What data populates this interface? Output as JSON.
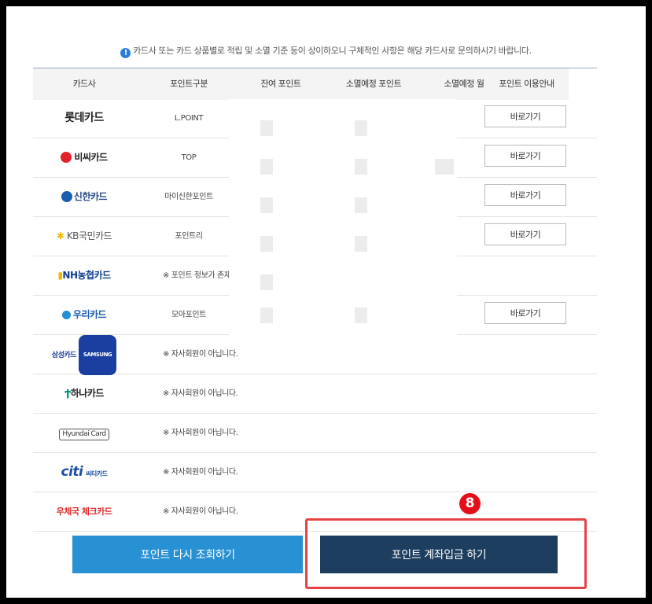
{
  "notice": {
    "icon": "info-icon",
    "icon_glyph": "!",
    "text": "카드사 또는 카드 상품별로 적립 및 소멸 기준 등이 상이하오니 구체적인 사항은 해당 카드사로 문의하시기 바랍니다."
  },
  "table": {
    "headers": [
      "카드사",
      "포인트구분",
      "잔여 포인트",
      "소멸예정 포인트",
      "소멸예정 월",
      "포인트 이용안내"
    ],
    "go_label": "바로가기",
    "rows": [
      {
        "card": "롯데카드",
        "point_type": "L.POINT",
        "has_button": true
      },
      {
        "card": "비씨카드",
        "point_type": "TOP",
        "has_button": true
      },
      {
        "card": "신한카드",
        "point_type": "마이신한포인트",
        "has_button": true
      },
      {
        "card": "KB국민카드",
        "point_type": "포인트리",
        "has_button": true
      },
      {
        "card": "NH농협카드",
        "point_type": "※ 포인트 정보가 존재하지 않",
        "has_button": false
      },
      {
        "card": "우리카드",
        "point_type": "모아포인트",
        "has_button": true
      },
      {
        "card": "삼성카드",
        "point_type": "※ 자사회원이 아닙니다.",
        "has_button": false
      },
      {
        "card": "하나카드",
        "point_type": "※ 자사회원이 아닙니다.",
        "has_button": false
      },
      {
        "card": "Hyundai Card",
        "point_type": "※ 자사회원이 아닙니다.",
        "has_button": false
      },
      {
        "card": "씨티카드",
        "point_type": "※ 자사회원이 아닙니다.",
        "has_button": false
      },
      {
        "card": "우체국 체크카드",
        "point_type": "※ 자사회원이 아닙니다.",
        "has_button": false
      }
    ]
  },
  "logos": {
    "kb_text": "KB국민카드",
    "samsung_text": "삼성카드",
    "samsung_badge": "SAMSUNG",
    "citi_mark": "citi",
    "citi_sub": "씨티카드"
  },
  "badge_number": "8",
  "buttons": {
    "refresh": "포인트 다시 조회하기",
    "deposit": "포인트 계좌입금 하기"
  },
  "colors": {
    "refresh_bg": "#2891d4",
    "deposit_bg": "#1e3e5f",
    "highlight": "#e74246",
    "badge": "#e30f1b"
  }
}
